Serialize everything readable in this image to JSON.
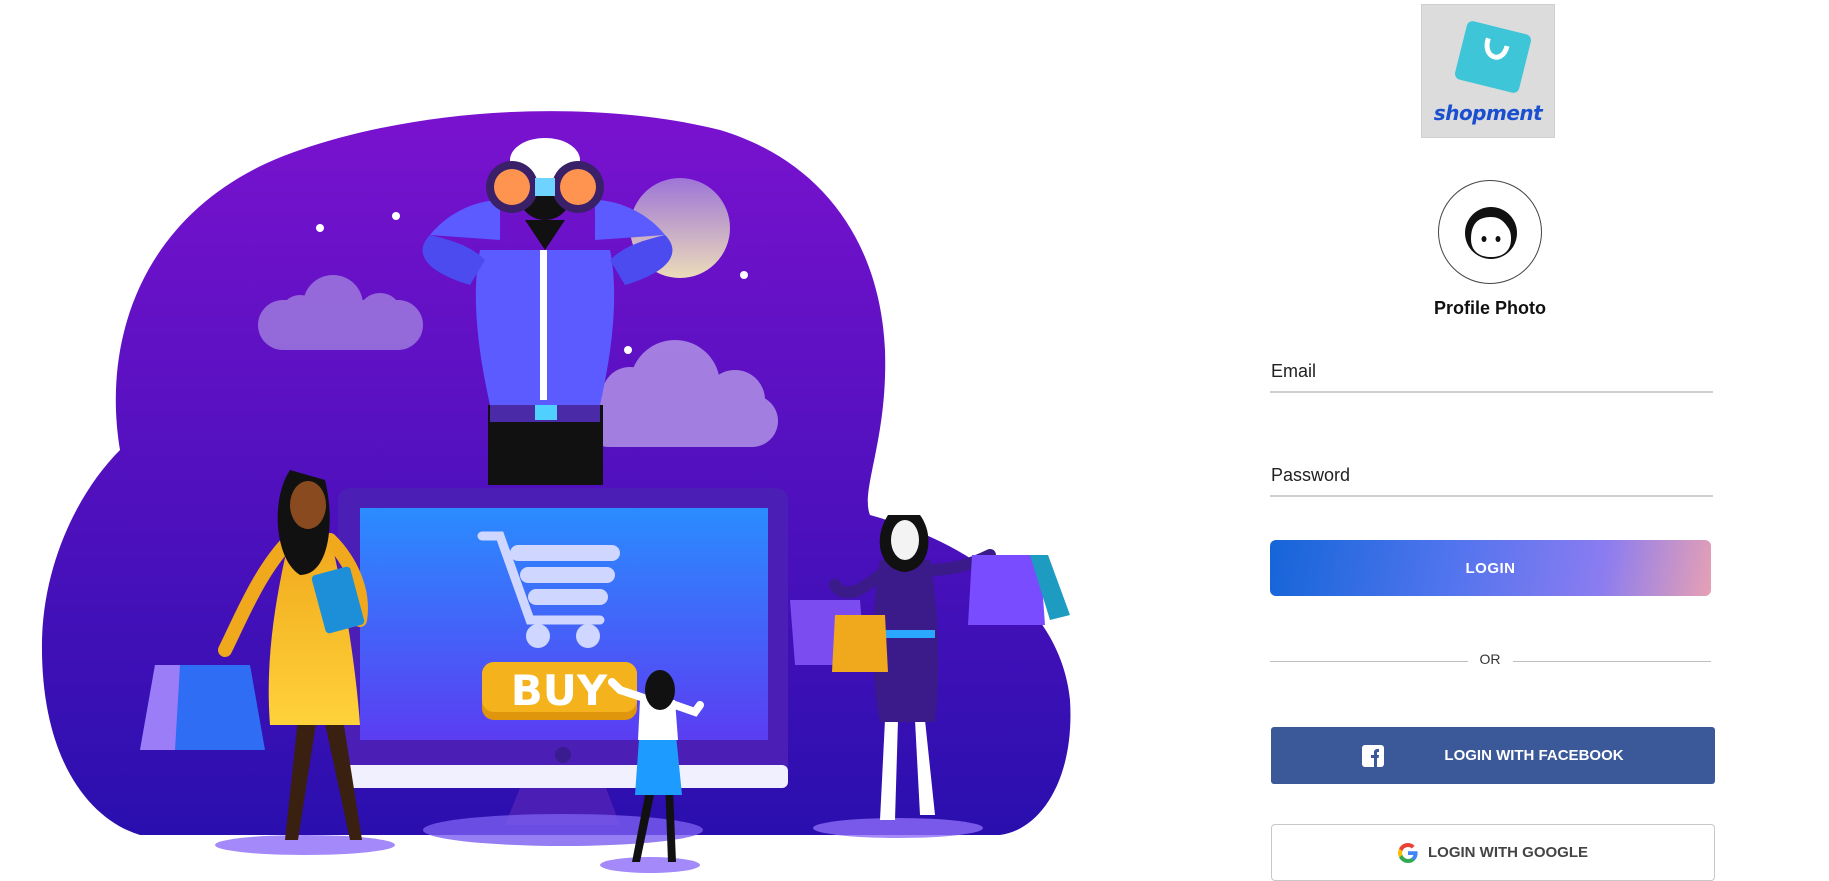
{
  "brand": {
    "logo_text": "shopment"
  },
  "hero": {
    "screen_button_label": "BUY"
  },
  "profile": {
    "label": "Profile Photo"
  },
  "form": {
    "email_placeholder": "Email",
    "password_placeholder": "Password",
    "login_label": "LOGIN",
    "or_label": "OR"
  },
  "social": {
    "facebook_label": "LOGIN WITH FACEBOOK",
    "google_label": "LOGIN WITH GOOGLE"
  },
  "colors": {
    "facebook": "#3b5998",
    "login_gradient_start": "#1565d8",
    "login_gradient_end": "#e6a0b4",
    "illustration_purple": "#5a10c8"
  }
}
